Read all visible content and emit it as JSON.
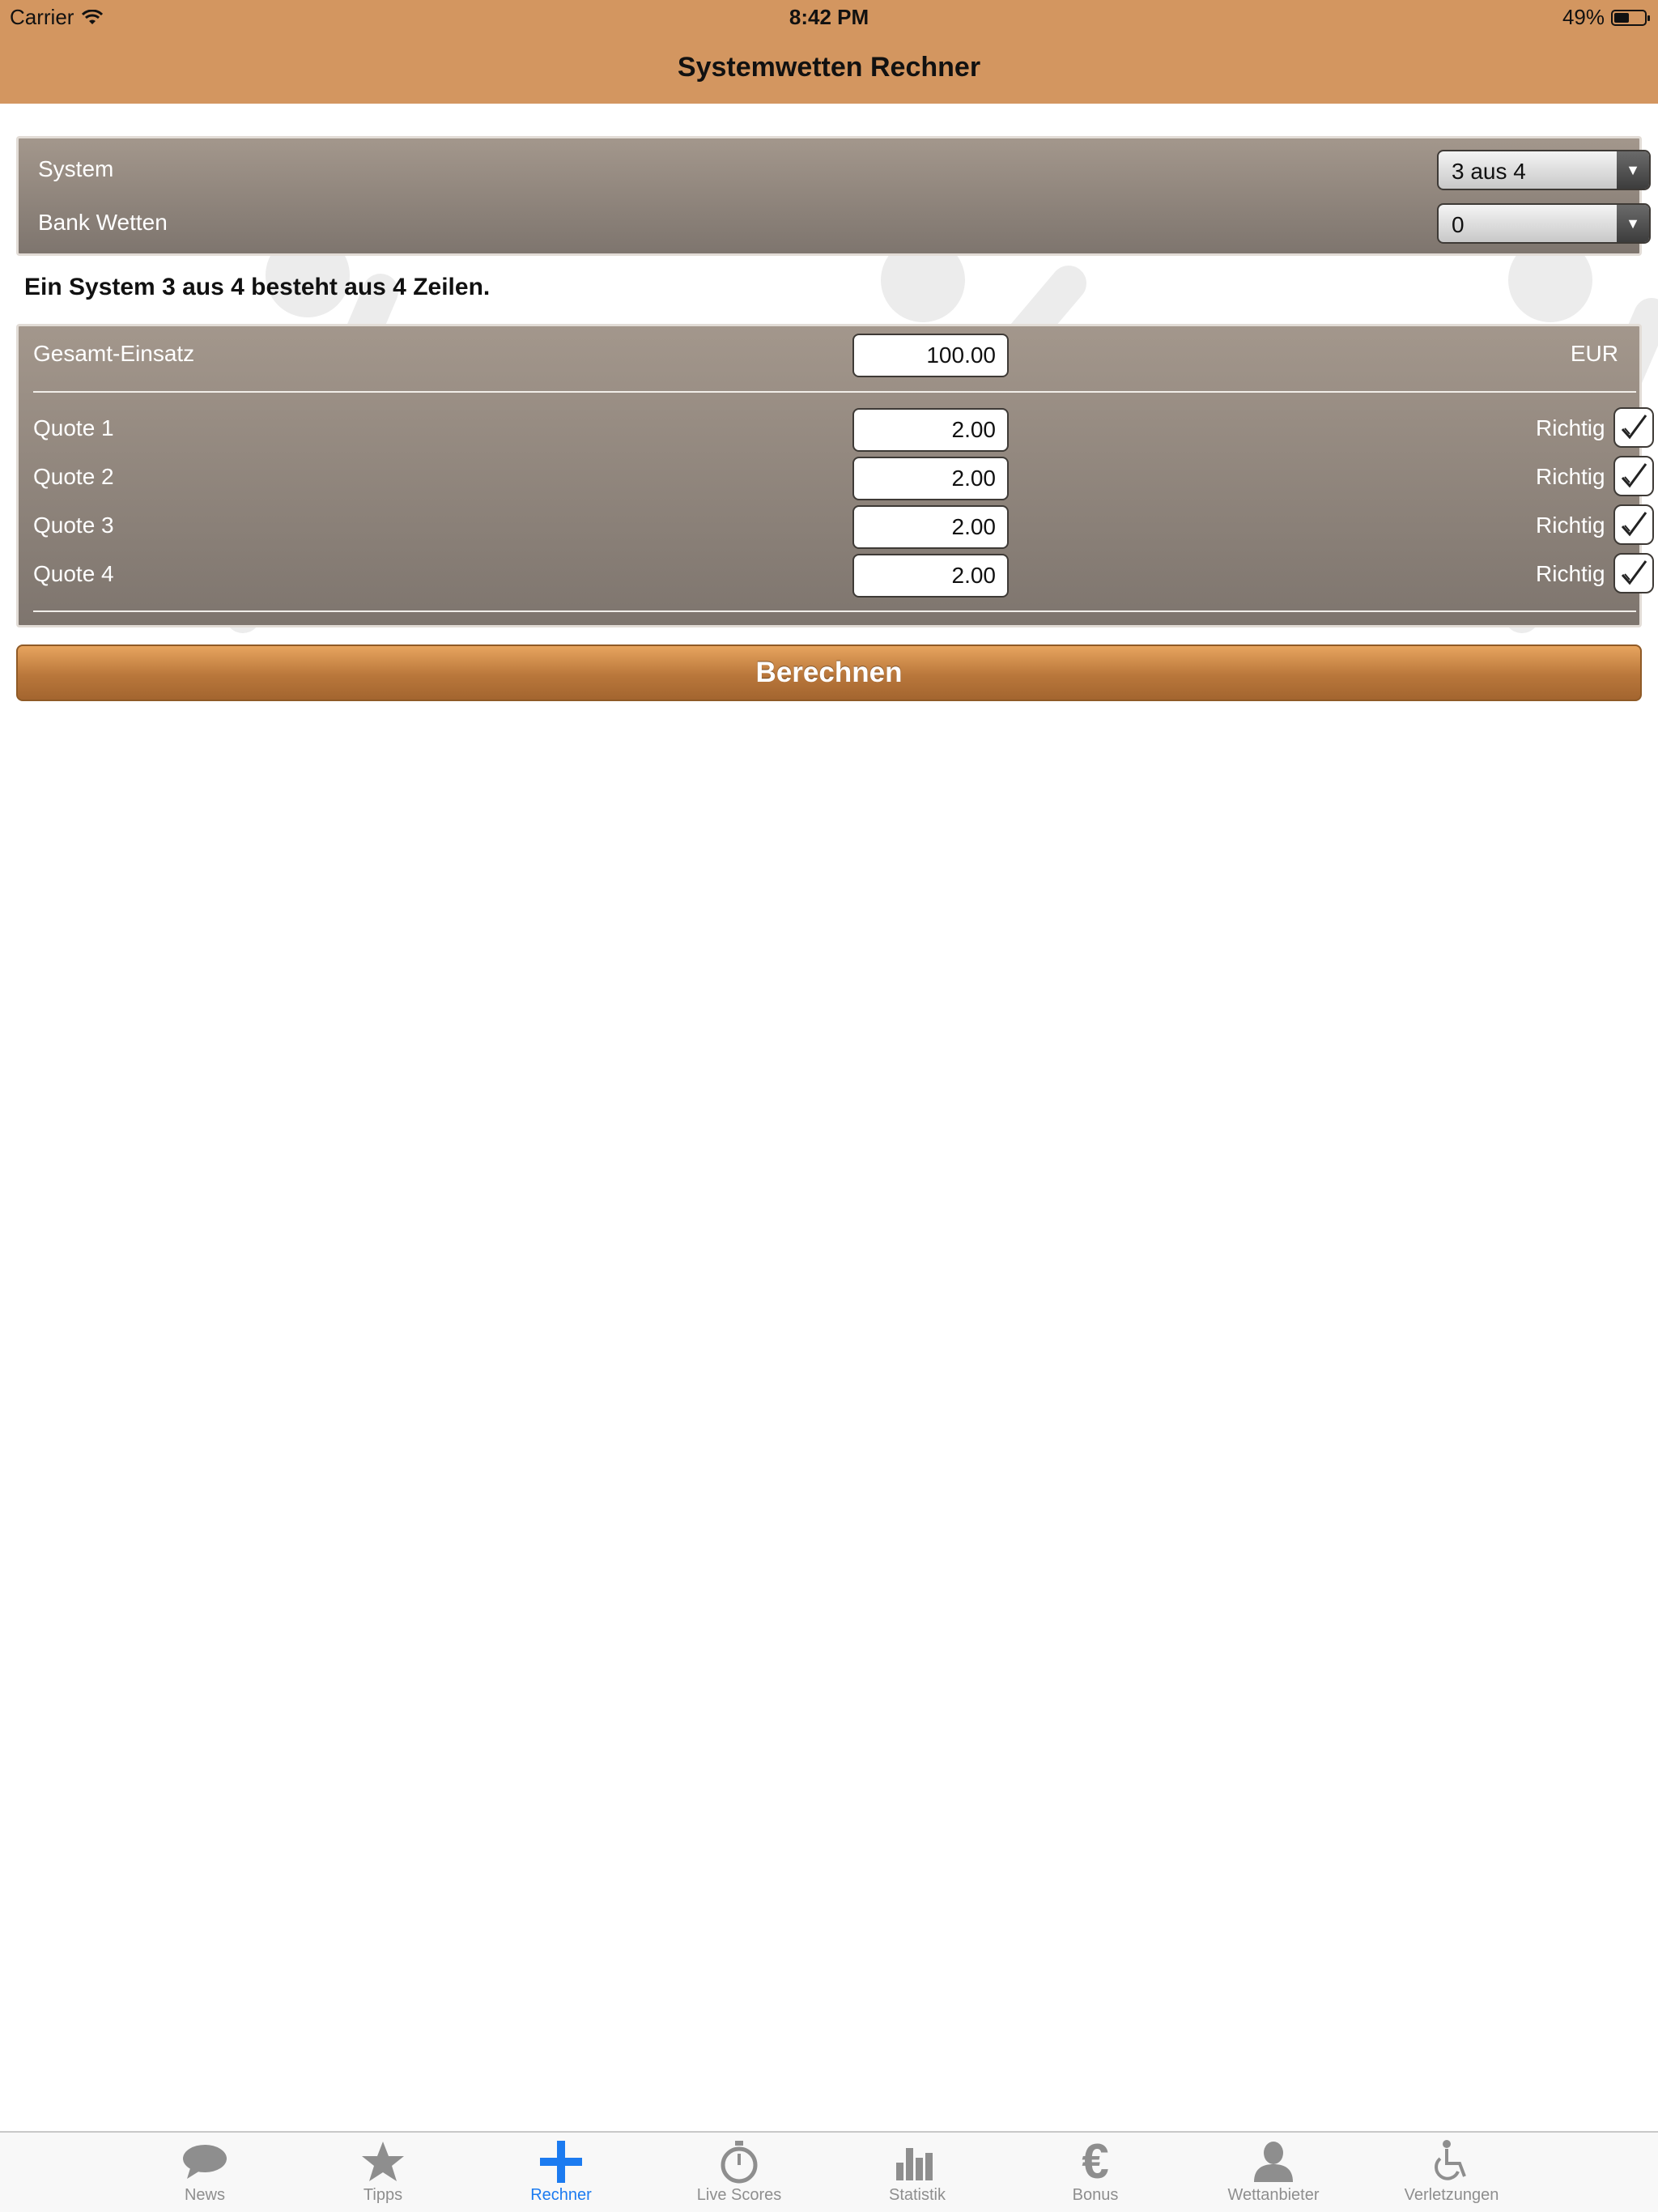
{
  "status_bar": {
    "carrier": "Carrier",
    "time": "8:42 PM",
    "battery": "49%",
    "battery_level": 0.49
  },
  "nav": {
    "title": "Systemwetten Rechner"
  },
  "system_panel": {
    "system_label": "System",
    "system_value": "3 aus 4",
    "bank_label": "Bank Wetten",
    "bank_value": "0"
  },
  "info_text": "Ein System 3 aus 4 besteht aus 4 Zeilen.",
  "stake": {
    "label": "Gesamt-Einsatz",
    "value": "100.00",
    "currency": "EUR"
  },
  "quotes": [
    {
      "label": "Quote 1",
      "value": "2.00",
      "result": "Richtig",
      "checked": true
    },
    {
      "label": "Quote 2",
      "value": "2.00",
      "result": "Richtig",
      "checked": true
    },
    {
      "label": "Quote 3",
      "value": "2.00",
      "result": "Richtig",
      "checked": true
    },
    {
      "label": "Quote 4",
      "value": "2.00",
      "result": "Richtig",
      "checked": true
    }
  ],
  "calculate_button": "Berechnen",
  "tabs": [
    {
      "label": "News",
      "icon": "speech-bubble-icon",
      "active": false
    },
    {
      "label": "Tipps",
      "icon": "star-icon",
      "active": false
    },
    {
      "label": "Rechner",
      "icon": "plus-icon",
      "active": true
    },
    {
      "label": "Live Scores",
      "icon": "stopwatch-icon",
      "active": false
    },
    {
      "label": "Statistik",
      "icon": "bar-chart-icon",
      "active": false
    },
    {
      "label": "Bonus",
      "icon": "euro-icon",
      "active": false
    },
    {
      "label": "Wettanbieter",
      "icon": "person-icon",
      "active": false
    },
    {
      "label": "Verletzungen",
      "icon": "wheelchair-icon",
      "active": false
    }
  ],
  "colors": {
    "nav": "#d39660",
    "accent": "#1c7bf0",
    "button": "#b9773b"
  }
}
